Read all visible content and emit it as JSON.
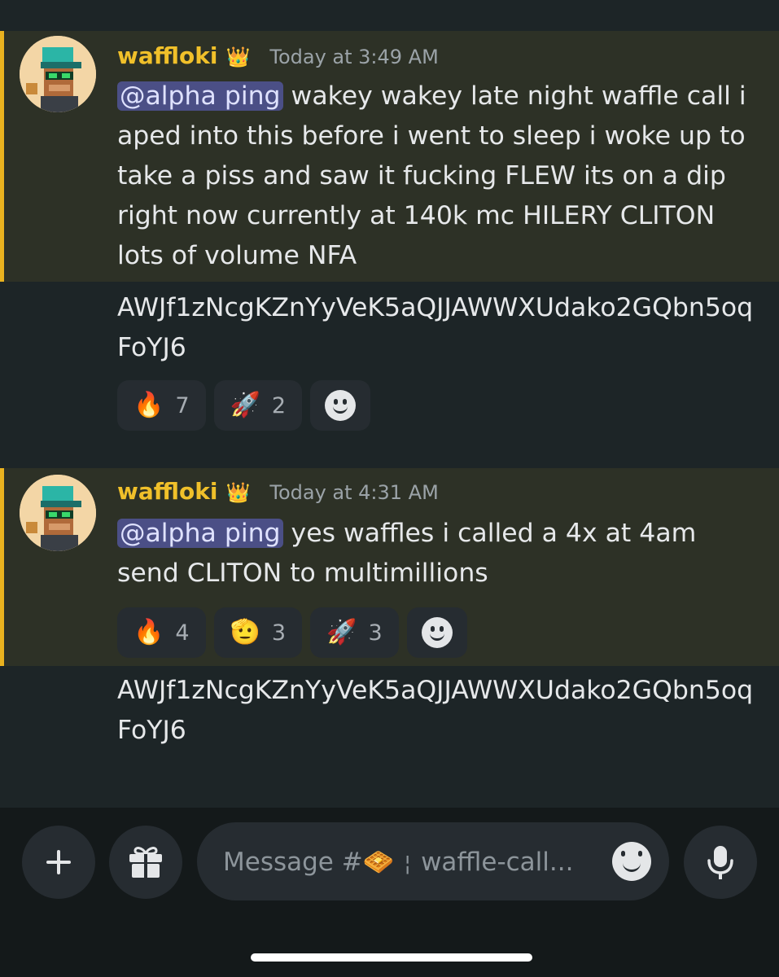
{
  "messages": [
    {
      "username": "waffloki",
      "crown": "👑",
      "timestamp": "Today at 3:49 AM",
      "mention": "@alpha ping",
      "text": " wakey wakey late night waffle call i aped into this before i went to sleep i woke up to take a piss and saw it fucking FLEW its on a dip right now currently at 140k mc HILERY CLITON lots of volume NFA",
      "followup": "AWJf1zNcgKZnYyVeK5aQJJAWWXUdako2GQbn5oqFoYJ6",
      "reactions": [
        {
          "emoji": "🔥",
          "count": "7"
        },
        {
          "emoji": "🚀",
          "count": "2"
        }
      ]
    },
    {
      "username": "waffloki",
      "crown": "👑",
      "timestamp": "Today at 4:31 AM",
      "mention": "@alpha ping",
      "text": " yes waffles i called a 4x at 4am send CLITON to multimillions",
      "reactions": [
        {
          "emoji": "🔥",
          "count": "4"
        },
        {
          "emoji": "🫡",
          "count": "3"
        },
        {
          "emoji": "🚀",
          "count": "3"
        }
      ],
      "followup": "AWJf1zNcgKZnYyVeK5aQJJAWWXUdako2GQbn5oqFoYJ6"
    }
  ],
  "composer": {
    "placeholder_prefix": "Message #🧇",
    "separator": "¦",
    "channel": "waffle-call..."
  },
  "colors": {
    "background": "#1d2527",
    "highlight": "#2d3126",
    "highlight_bar": "#e9b21f",
    "username": "#f0c02a",
    "mention_bg": "#4b4f86"
  },
  "icons": [
    "plus-icon",
    "gift-icon",
    "emoji-smile-icon",
    "microphone-icon"
  ]
}
